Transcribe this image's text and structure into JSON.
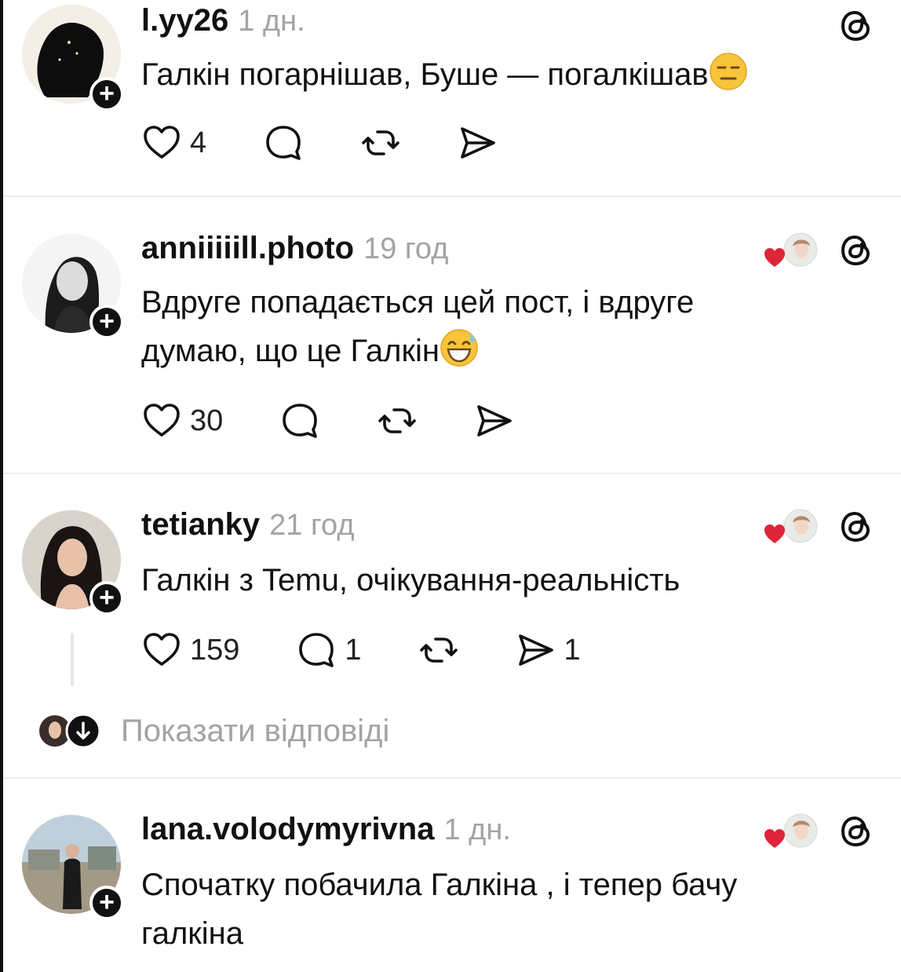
{
  "posts": [
    {
      "username": "l.yy26",
      "time": "1 дн.",
      "text": "Галкін погарнішав, Буше — погалкішав",
      "emoji": "expressionless-face",
      "likes": "4",
      "replies": "",
      "reposts": "",
      "shares": "",
      "liked_by_author": false
    },
    {
      "username": "anniiiiill.photo",
      "time": "19 год",
      "text": "Вдруге попадається цей пост, і вдруге думаю, що це Галкін",
      "emoji": "grinning-face-with-sweat",
      "likes": "30",
      "replies": "",
      "reposts": "",
      "shares": "",
      "liked_by_author": true
    },
    {
      "username": "tetianky",
      "time": "21 год",
      "text": "Галкін з Temu, очікування-реальність",
      "emoji": "",
      "likes": "159",
      "replies": "1",
      "reposts": "",
      "shares": "1",
      "liked_by_author": true,
      "show_replies_label": "Показати відповіді"
    },
    {
      "username": "lana.volodymyrivna",
      "time": "1 дн.",
      "text": "Спочатку побачила Галкіна , і тепер бачу галкіна",
      "emoji": "",
      "likes": "",
      "replies": "",
      "reposts": "",
      "shares": "",
      "liked_by_author": true
    }
  ],
  "icons": {
    "like": "heart-icon",
    "reply": "comment-bubble-icon",
    "repost": "repost-icon",
    "share": "send-icon",
    "brand": "threads-logo-icon",
    "follow": "plus-icon"
  },
  "colors": {
    "like_red": "#e0243a",
    "muted_text": "#a3a3a3"
  }
}
